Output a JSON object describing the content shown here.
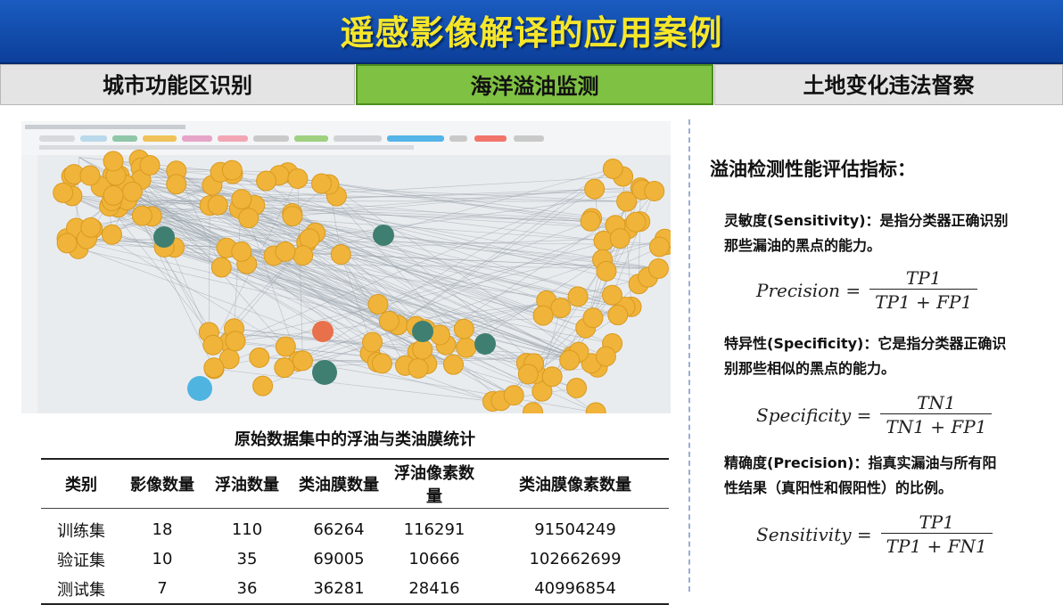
{
  "header": {
    "title": "遥感影像解译的应用案例"
  },
  "tabs": [
    {
      "label": "城市功能区识别",
      "active": false
    },
    {
      "label": "海洋溢油监测",
      "active": true
    },
    {
      "label": "土地变化违法督察",
      "active": false
    }
  ],
  "colors": {
    "title_bg": "#1a5cc0",
    "title_text": "#f6e62a",
    "active_tab": "#7fc142",
    "node_orange": "#f0b43a",
    "node_green": "#3f7f71",
    "node_blue": "#4fb4e0",
    "node_red": "#e8704a"
  },
  "table": {
    "title": "原始数据集中的浮油与类油膜统计",
    "headers": [
      "类别",
      "影像数量",
      "浮油数量",
      "类油膜数量",
      "浮油像素数量",
      "类油膜像素数量"
    ],
    "rows": [
      [
        "训练集",
        "18",
        "110",
        "66264",
        "116291",
        "91504249"
      ],
      [
        "验证集",
        "10",
        "35",
        "69005",
        "10666",
        "102662699"
      ],
      [
        "测试集",
        "7",
        "36",
        "36281",
        "28416",
        "40996854"
      ]
    ]
  },
  "metrics": {
    "title": "溢油检测性能评估指标：",
    "sensitivity_text": "灵敏度(Sensitivity)：是指分类器正确识别那些漏油的黑点的能力。",
    "specificity_text": "特异性(Specificity)：它是指分类器正确识别那些相似的黑点的能力。",
    "precision_text": "精确度(Precision)：指真实漏油与所有阳性结果（真阳性和假阳性）的比例。",
    "formulas": [
      {
        "lhs": "Precision =",
        "num": "TP1",
        "den": "TP1 + FP1"
      },
      {
        "lhs": "Specificity =",
        "num": "TN1",
        "den": "TN1 + FP1"
      },
      {
        "lhs": "Sensitivity =",
        "num": "TP1",
        "den": "TP1 + FN1"
      }
    ]
  }
}
